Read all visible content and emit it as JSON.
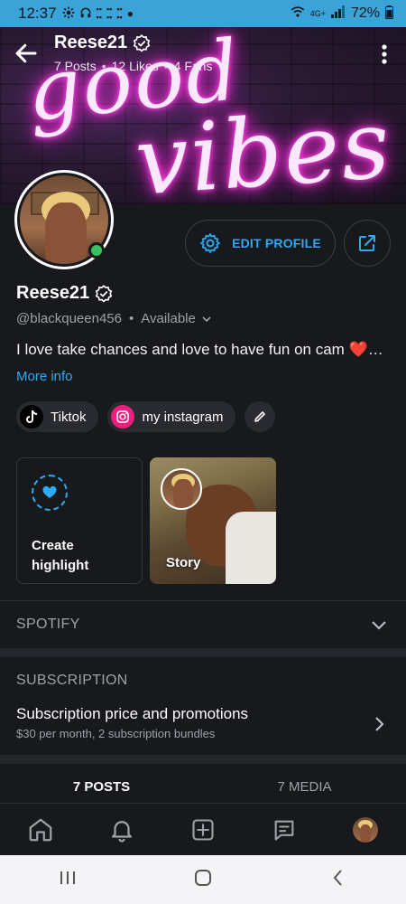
{
  "status_bar": {
    "time": "12:37",
    "battery": "72%",
    "network": "4G+"
  },
  "header": {
    "title": "Reese21",
    "stats": {
      "posts": "7 Posts",
      "likes": "12 Likes",
      "fans": "4 Fans"
    },
    "banner_text_1": "good",
    "banner_text_2": "vibes"
  },
  "profile": {
    "name": "Reese21",
    "handle": "@blackqueen456",
    "availability": "Available",
    "bio": "I love take chances and love to have fun on cam ❤️…",
    "more_info_label": "More info",
    "edit_profile_label": "EDIT PROFILE"
  },
  "links": [
    {
      "label": "Tiktok"
    },
    {
      "label": "my instagram"
    }
  ],
  "highlights": {
    "create_label": "Create highlight",
    "story_label": "Story"
  },
  "spotify": {
    "title": "SPOTIFY"
  },
  "subscription": {
    "section_title": "SUBSCRIPTION",
    "item_title": "Subscription price and promotions",
    "item_detail": "$30 per month, 2 subscription bundles"
  },
  "tabs": [
    {
      "label": "7 POSTS",
      "active": true
    },
    {
      "label": "7 MEDIA",
      "active": false
    }
  ],
  "colors": {
    "accent": "#2fa9f0",
    "online": "#36c25a",
    "instagram": "#ec1f7c",
    "status_bar": "#3aa3d8"
  }
}
